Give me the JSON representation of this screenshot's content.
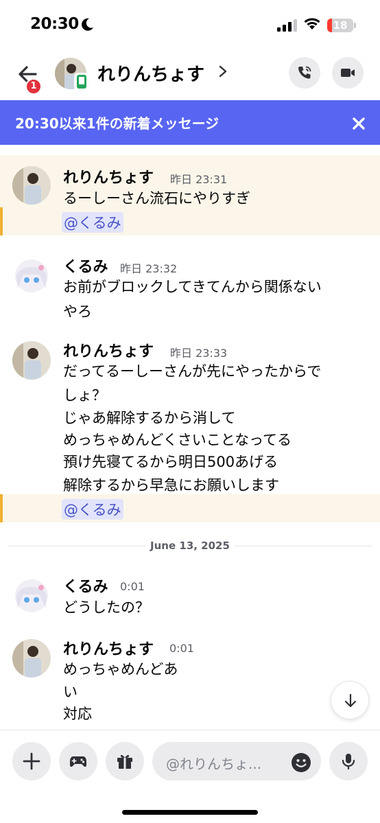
{
  "status_bar": {
    "time": "20:30",
    "battery": "18",
    "battery_level": 0.18,
    "icons": [
      "moon-icon",
      "cellular-signal-icon",
      "wifi-icon",
      "battery-icon"
    ]
  },
  "header": {
    "back_badge": "1",
    "title": "れりんちょす",
    "icons": [
      "back-arrow-icon",
      "mobile-icon",
      "chevron-right-icon",
      "phone-call-icon",
      "video-camera-icon"
    ]
  },
  "banner": {
    "text": "20:30以来1件の新着メッセージ",
    "close_icon": "close-icon"
  },
  "messages": [
    {
      "author": "れりんちょす",
      "time": "昨日 23:31",
      "lines": [
        "るーしーさん流石にやりすぎ"
      ],
      "mention": "@くるみ"
    },
    {
      "author": "くるみ",
      "time": "昨日 23:32",
      "lines": [
        "お前がブロックしてきてんから関係ない",
        "やろ"
      ]
    },
    {
      "author": "れりんちょす",
      "time": "昨日 23:33",
      "lines": [
        "だってるーしーさんが先にやったからで",
        "しょ？",
        "じゃあ解除するから消して",
        "めっちゃめんどくさいことなってる",
        "預け先寝てるから明日500あげる",
        "解除するから早急にお願いします"
      ],
      "mention": "@くるみ"
    },
    {
      "author": "くるみ",
      "time": "0:01",
      "lines": [
        "どうしたの？"
      ]
    },
    {
      "author": "れりんちょす",
      "time": "0:01",
      "lines": [
        "めっちゃめんどあ",
        "い",
        "対応"
      ]
    }
  ],
  "date_divider": "June 13, 2025",
  "composer": {
    "placeholder": "@れりんちょ...",
    "icons": [
      "plus-icon",
      "gamepad-icon",
      "gift-icon",
      "emoji-icon",
      "microphone-icon",
      "arrow-down-icon"
    ]
  },
  "colors": {
    "accent": "#5865f2",
    "mention_bg": "#fbf6e9",
    "mention_bar": "#f0b132",
    "mention_text": "#4752c4",
    "badge_red": "#e2323e",
    "online_green": "#23a55a"
  }
}
